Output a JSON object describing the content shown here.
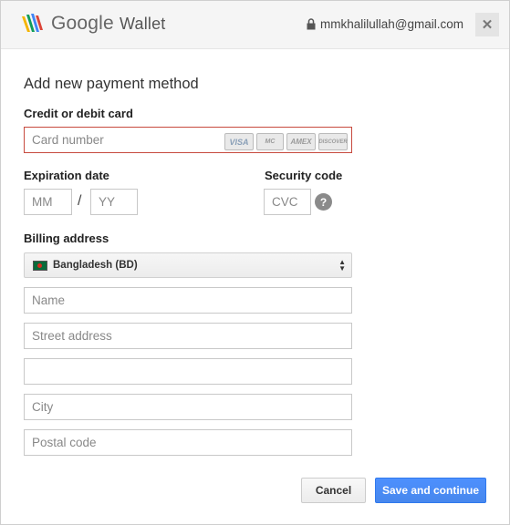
{
  "header": {
    "brand_google": "Google",
    "brand_wallet": "Wallet",
    "account_email": "mmkhalilullah@gmail.com",
    "close_label": "✕"
  },
  "form": {
    "title": "Add new payment method",
    "card_section_label": "Credit or debit card",
    "card_number_placeholder": "Card number",
    "card_logos": [
      "VISA",
      "MC",
      "AMEX",
      "DISCOVER"
    ],
    "expiration_label": "Expiration date",
    "month_placeholder": "MM",
    "date_separator": "/",
    "year_placeholder": "YY",
    "security_label": "Security code",
    "cvc_placeholder": "CVC",
    "help_label": "?",
    "billing_label": "Billing address",
    "country_selected": "Bangladesh (BD)",
    "name_placeholder": "Name",
    "street_placeholder": "Street address",
    "street2_placeholder": "",
    "city_placeholder": "City",
    "postal_placeholder": "Postal code"
  },
  "actions": {
    "cancel_label": "Cancel",
    "save_label": "Save and continue"
  },
  "colors": {
    "accent_blue": "#4d90fe",
    "error_border": "#c74a3e",
    "header_bg": "#f5f5f5"
  },
  "icons": [
    "google-wallet-logo-icon",
    "lock-icon",
    "close-icon",
    "help-icon",
    "bangladesh-flag-icon",
    "select-arrows-icon"
  ]
}
